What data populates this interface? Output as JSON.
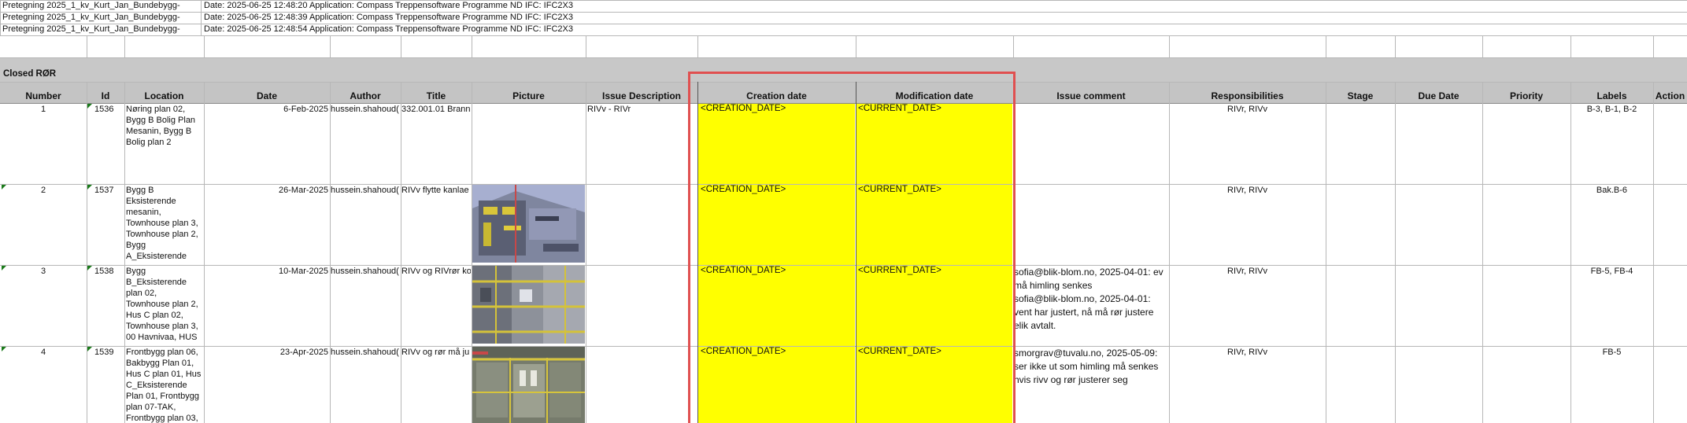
{
  "top_rows": [
    {
      "name": "Pretegning 2025_1_kv_Kurt_Jan_Bundebygg-",
      "info": "Date: 2025-06-25 12:48:20 Application: Compass Treppensoftware Programme ND IFC: IFC2X3"
    },
    {
      "name": "Pretegning 2025_1_kv_Kurt_Jan_Bundebygg-",
      "info": "Date: 2025-06-25 12:48:39 Application: Compass Treppensoftware Programme ND IFC: IFC2X3"
    },
    {
      "name": "Pretegning 2025_1_kv_Kurt_Jan_Bundebygg-",
      "info": "Date: 2025-06-25 12:48:54 Application: Compass Treppensoftware Programme ND IFC: IFC2X3"
    }
  ],
  "section_title": "Closed RØR",
  "headers": {
    "number": "Number",
    "id": "Id",
    "location": "Location",
    "date": "Date",
    "author": "Author",
    "title": "Title",
    "picture": "Picture",
    "issue_description": "Issue Description",
    "creation_date": "Creation date",
    "modification_date": "Modification date",
    "issue_comment": "Issue comment",
    "responsibilities": "Responsibilities",
    "stage": "Stage",
    "due_date": "Due Date",
    "priority": "Priority",
    "labels": "Labels",
    "action": "Action"
  },
  "rows": [
    {
      "number": "1",
      "id": "1536",
      "location": [
        "Nøring plan 02,",
        "Bygg B Bolig Plan",
        "Mesanin, Bygg B",
        "Bolig plan 2"
      ],
      "date": "6-Feb-2025",
      "author": "hussein.shahoud(",
      "title": "332.001.01 Brann",
      "issue_description": "RIVv - RIVr",
      "creation_date": "<CREATION_DATE>",
      "modification_date": "<CURRENT_DATE>",
      "issue_comment": [],
      "responsibilities": "RIVr, RIVv",
      "labels": "B-3, B-1, B-2"
    },
    {
      "number": "2",
      "id": "1537",
      "location": [
        "Bygg B",
        "Eksisterende",
        "mesanin,",
        "Townhouse plan 3,",
        "Townhouse plan 2,",
        "Bygg",
        "A_Eksisterende"
      ],
      "date": "26-Mar-2025",
      "author": "hussein.shahoud(",
      "title": "RIVv flytte kanlae",
      "issue_description": "",
      "creation_date": "<CREATION_DATE>",
      "modification_date": "<CURRENT_DATE>",
      "issue_comment": [],
      "responsibilities": "RIVr, RIVv",
      "labels": "Bak.B-6"
    },
    {
      "number": "3",
      "id": "1538",
      "location": [
        "Bygg",
        "B_Eksisterende",
        "plan 02,",
        "Townhouse plan 2,",
        "Hus C plan 02,",
        "Townhouse plan 3,",
        "00 Havnivaa, HUS"
      ],
      "date": "10-Mar-2025",
      "author": "hussein.shahoud(",
      "title": "RIVv og RIVrør ko",
      "issue_description": "",
      "creation_date": "<CREATION_DATE>",
      "modification_date": "<CURRENT_DATE>",
      "issue_comment": [
        "sofia@blik-blom.no, 2025-04-01: ev",
        "må himling senkes",
        "sofia@blik-blom.no, 2025-04-01:",
        "vent har justert, nå må rør justere",
        "elik avtalt."
      ],
      "responsibilities": "RIVr, RIVv",
      "labels": "FB-5, FB-4"
    },
    {
      "number": "4",
      "id": "1539",
      "location": [
        "Frontbygg plan 06,",
        "Bakbygg Plan 01,",
        "Hus C plan 01, Hus",
        "C_Eksisterende",
        "Plan 01, Frontbygg",
        "plan 07-TAK,",
        "Frontbygg plan 03,"
      ],
      "date": "23-Apr-2025",
      "author": "hussein.shahoud(",
      "title": "RIVv og rør må ju",
      "issue_description": "",
      "creation_date": "<CREATION_DATE>",
      "modification_date": "<CURRENT_DATE>",
      "issue_comment": [
        "smorgrav@tuvalu.no, 2025-05-09:",
        "ser ikke ut som himling må senkes",
        "hvis rivv og rør justerer seg"
      ],
      "responsibilities": "RIVr, RIVv",
      "labels": "FB-5"
    }
  ],
  "colors": {
    "highlight": "#ffff00",
    "box": "#e05050",
    "header_band": "#c8c8c8",
    "grid": "#b7b7b7"
  }
}
